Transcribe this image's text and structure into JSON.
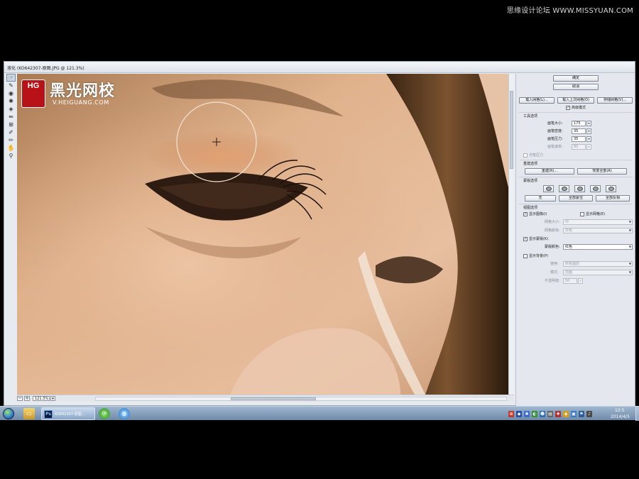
{
  "watermark": {
    "top_right": "思缘设计论坛 WWW.MISSYUAN.COM",
    "logo_badge": "HG",
    "logo_name": "黑光网校",
    "logo_url": "V.HEIGUANG.COM"
  },
  "window": {
    "title": "液化 (KO642307-原图.JPG @ 121.3%)"
  },
  "toolbox": {
    "tools": [
      {
        "name": "forward-warp-tool",
        "glyph": "☞"
      },
      {
        "name": "reconstruct-tool",
        "glyph": "✎"
      },
      {
        "name": "twirl-clockwise-tool",
        "glyph": "◉"
      },
      {
        "name": "pucker-tool",
        "glyph": "✺"
      },
      {
        "name": "bloat-tool",
        "glyph": "◈"
      },
      {
        "name": "push-left-tool",
        "glyph": "⇚"
      },
      {
        "name": "mirror-tool",
        "glyph": "⊞"
      },
      {
        "name": "freeze-mask-tool",
        "glyph": "✐"
      },
      {
        "name": "thaw-mask-tool",
        "glyph": "✏"
      },
      {
        "name": "hand-tool",
        "glyph": "✋"
      },
      {
        "name": "zoom-tool",
        "glyph": "⚲"
      }
    ]
  },
  "statusbar": {
    "zoom_out": "−",
    "zoom_in": "+",
    "zoom_value": "121.3%",
    "zoom_dropdown": "▾"
  },
  "panel": {
    "ok": "确定",
    "cancel": "取消",
    "load_mesh": "载入网格(L)...",
    "load_last_mesh": "载入上次网格(O)",
    "save_mesh": "存储网格(V)...",
    "advanced_mode": "高级模式",
    "tool_options": {
      "heading": "工具选项",
      "brush_size_label": "画笔大小:",
      "brush_size": "175",
      "brush_density_label": "画笔密度:",
      "brush_density": "35",
      "brush_pressure_label": "画笔压力:",
      "brush_pressure": "35",
      "brush_rate_label": "画笔速率:",
      "brush_rate": "80",
      "stylus_pressure": "光笔压力"
    },
    "reconstruct_options": {
      "heading": "重建选项",
      "reconstruct": "重建(R)...",
      "restore_all": "恢复全部(A)"
    },
    "mask_options": {
      "heading": "蒙版选项",
      "none": "无",
      "mask_all": "全部蒙住",
      "invert_all": "全部反相"
    },
    "view_options": {
      "heading": "视图选项",
      "show_image": "显示图像(I)",
      "show_mesh": "显示网格(E)",
      "mesh_size_label": "网格大小:",
      "mesh_size": "中",
      "mesh_color_label": "网格颜色:",
      "mesh_color": "灰色",
      "show_mask": "显示蒙版(K)",
      "mask_color_label": "蒙版颜色:",
      "mask_color": "红色",
      "show_backdrop": "显示背景(P)",
      "use_label": "使用:",
      "use_value": "所有图层",
      "mode_label": "模式:",
      "mode_value": "前面",
      "opacity_label": "不透明度:",
      "opacity_value": "50"
    }
  },
  "taskbar": {
    "task_label": "KO642307-原图...",
    "ps_badge": "Ps",
    "clock_time": "12:5",
    "clock_date": "2014/4/5"
  },
  "colors": {
    "skin_light": "#e3b896",
    "skin_mid": "#c9956c",
    "skin_dark": "#8e5c3c",
    "hair": "#5a3a20",
    "brush_circle": "#f2e2cf",
    "watermark_red": "#c0151b"
  }
}
